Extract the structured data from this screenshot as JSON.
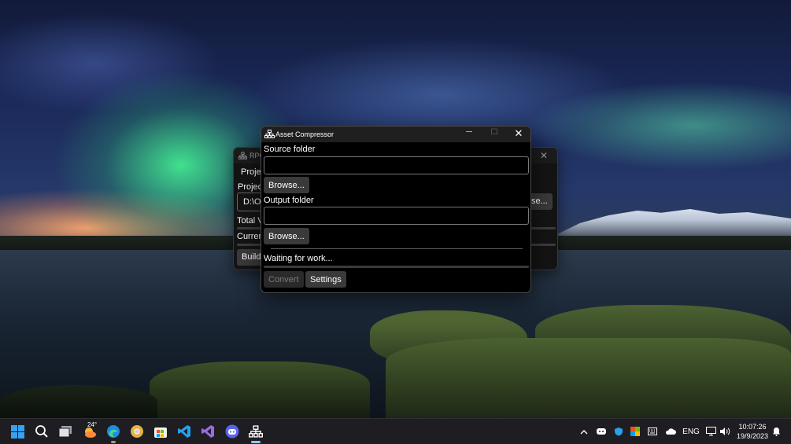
{
  "colors": {
    "accent": "#3fa0ff",
    "window_bg": "#000000",
    "button_bg": "#3a3a3a",
    "taskbar_bg": "#1e1e22"
  },
  "background_window": {
    "title": "RPG",
    "labels": {
      "project_tab": "Projec",
      "project_label": "Project",
      "path_value": "D:\\O",
      "browse": "se...",
      "total": "Total V",
      "current": "Curren",
      "build": "Build"
    },
    "icons": {
      "app": "network-icon",
      "close": "close-icon"
    }
  },
  "window": {
    "title": "Asset Compressor",
    "icons": {
      "app": "network-icon",
      "minimize": "minimize-icon",
      "maximize": "maximize-icon",
      "close": "close-icon"
    },
    "source": {
      "label": "Source folder",
      "value": "",
      "browse_label": "Browse..."
    },
    "output": {
      "label": "Output folder",
      "value": "",
      "browse_label": "Browse..."
    },
    "status": "Waiting for work...",
    "progress": 0,
    "convert_label": "Convert",
    "settings_label": "Settings"
  },
  "taskbar": {
    "apps": [
      {
        "name": "start",
        "icon": "windows-start-icon"
      },
      {
        "name": "search",
        "icon": "search-icon"
      },
      {
        "name": "task-view",
        "icon": "task-view-icon"
      },
      {
        "name": "weather",
        "icon": "weather-icon",
        "badge": "24°"
      },
      {
        "name": "edge",
        "icon": "edge-icon"
      },
      {
        "name": "chrome",
        "icon": "chrome-icon"
      },
      {
        "name": "store",
        "icon": "store-icon"
      },
      {
        "name": "vscode",
        "icon": "vscode-icon"
      },
      {
        "name": "visual-studio",
        "icon": "visual-studio-icon"
      },
      {
        "name": "discord",
        "icon": "discord-icon"
      },
      {
        "name": "asset-compressor",
        "icon": "network-icon"
      }
    ],
    "tray": {
      "language": "ENG",
      "time": "10:07:26",
      "date": "19/9/2023",
      "icons": [
        "chevron-up-icon",
        "discord-tray-icon",
        "shield-icon",
        "color-grid-icon",
        "keyboard-icon",
        "cloud-icon",
        "network-icon",
        "volume-icon",
        "notification-bell-icon"
      ]
    }
  }
}
